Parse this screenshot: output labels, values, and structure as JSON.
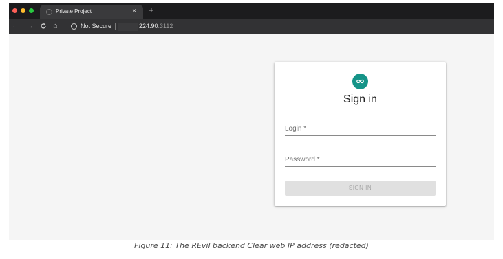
{
  "browser": {
    "tab": {
      "title": "Private Project",
      "close_glyph": "×"
    },
    "new_tab_glyph": "+",
    "nav": {
      "back": "←",
      "forward": "→",
      "reload": "C",
      "home": "⌂"
    },
    "address": {
      "security_label": "Not Secure",
      "host_visible": "224.90",
      "port": ":3112",
      "host_redacted": true
    },
    "icons": [
      "tab-favicon-icon",
      "close-icon",
      "plus-icon",
      "back-arrow-icon",
      "forward-arrow-icon",
      "reload-icon",
      "home-icon",
      "info-icon"
    ],
    "traffic_lights": [
      "#fe5f57",
      "#febc2e",
      "#28c840"
    ]
  },
  "login": {
    "avatar_icon": "infinity-icon",
    "avatar_color": "#159488",
    "title": "Sign in",
    "login_placeholder": "Login *",
    "password_placeholder": "Password *",
    "submit_label": "SIGN IN"
  },
  "caption": "Figure 11: The REvil backend Clear web IP address (redacted)"
}
